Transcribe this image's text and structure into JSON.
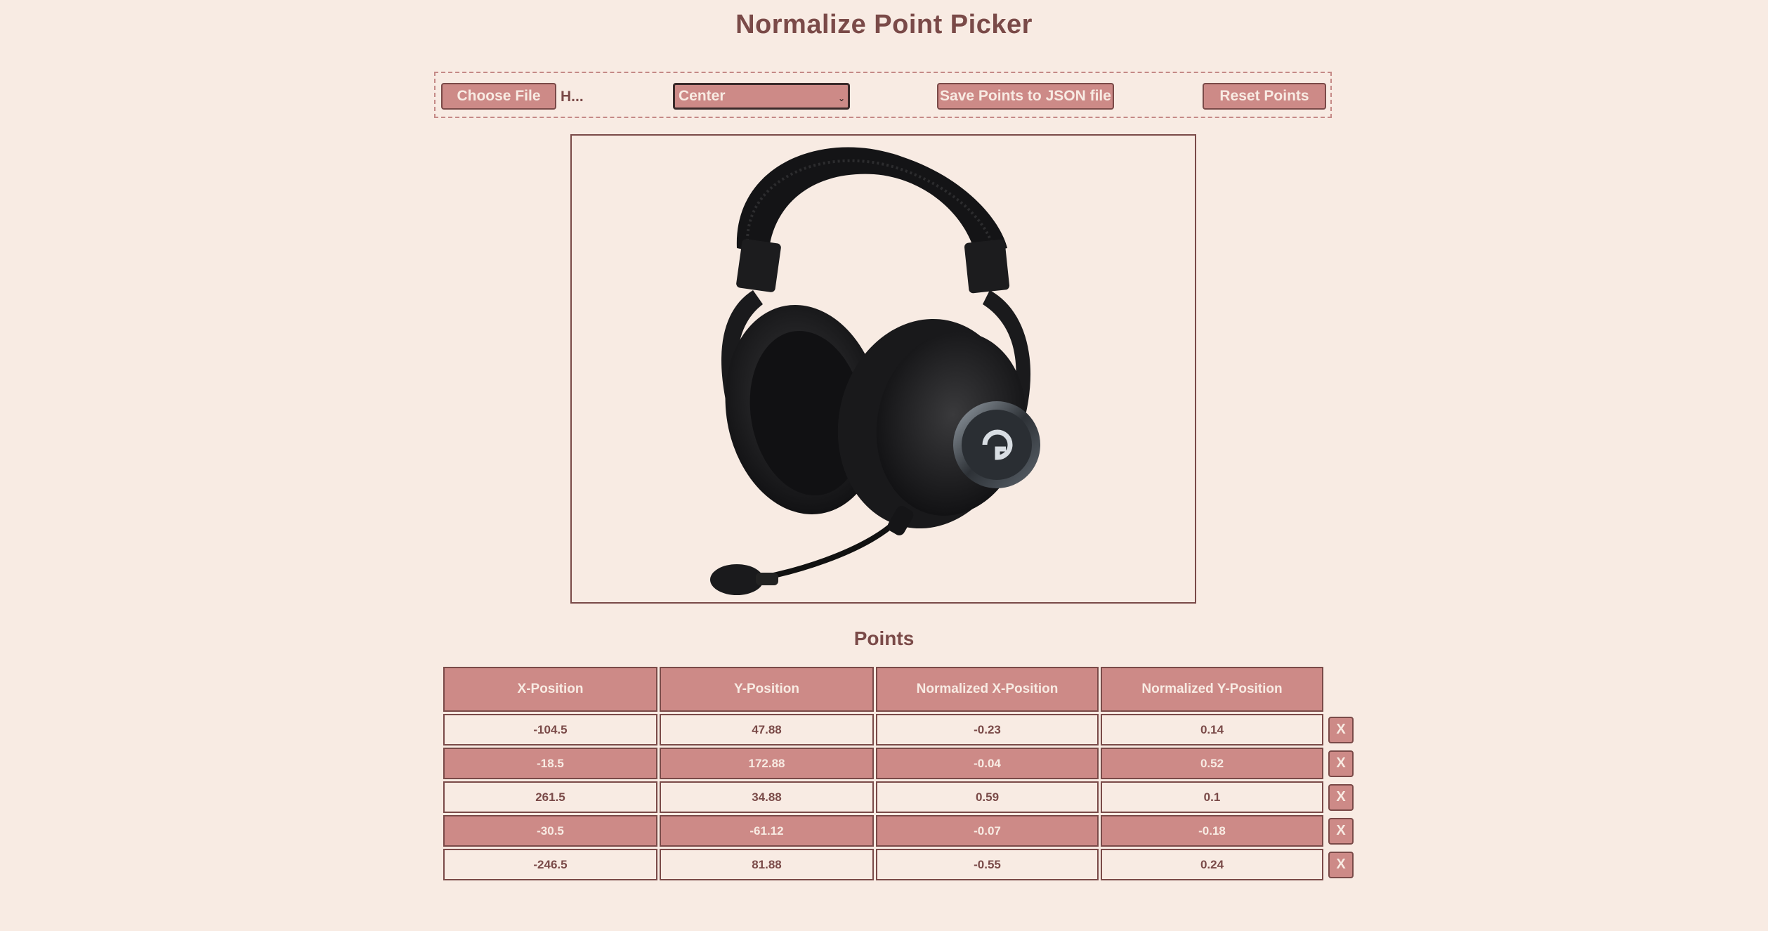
{
  "title": "Normalize Point Picker",
  "toolbar": {
    "choose_file_label": "Choose File",
    "file_name": "H...",
    "origin_select_value": "Center",
    "save_label": "Save Points to JSON file",
    "reset_label": "Reset Points"
  },
  "canvas": {
    "image_subject": "headset-image"
  },
  "points": {
    "heading": "Points",
    "columns": [
      "X-Position",
      "Y-Position",
      "Normalized X-Position",
      "Normalized Y-Position"
    ],
    "delete_label": "X",
    "rows": [
      {
        "x": "-104.5",
        "y": "47.88",
        "nx": "-0.23",
        "ny": "0.14"
      },
      {
        "x": "-18.5",
        "y": "172.88",
        "nx": "-0.04",
        "ny": "0.52"
      },
      {
        "x": "261.5",
        "y": "34.88",
        "nx": "0.59",
        "ny": "0.1"
      },
      {
        "x": "-30.5",
        "y": "-61.12",
        "nx": "-0.07",
        "ny": "-0.18"
      },
      {
        "x": "-246.5",
        "y": "81.88",
        "nx": "-0.55",
        "ny": "0.24"
      }
    ]
  },
  "colors": {
    "background": "#f8ebe3",
    "accent": "#cd8a87",
    "text": "#7a4a48"
  }
}
